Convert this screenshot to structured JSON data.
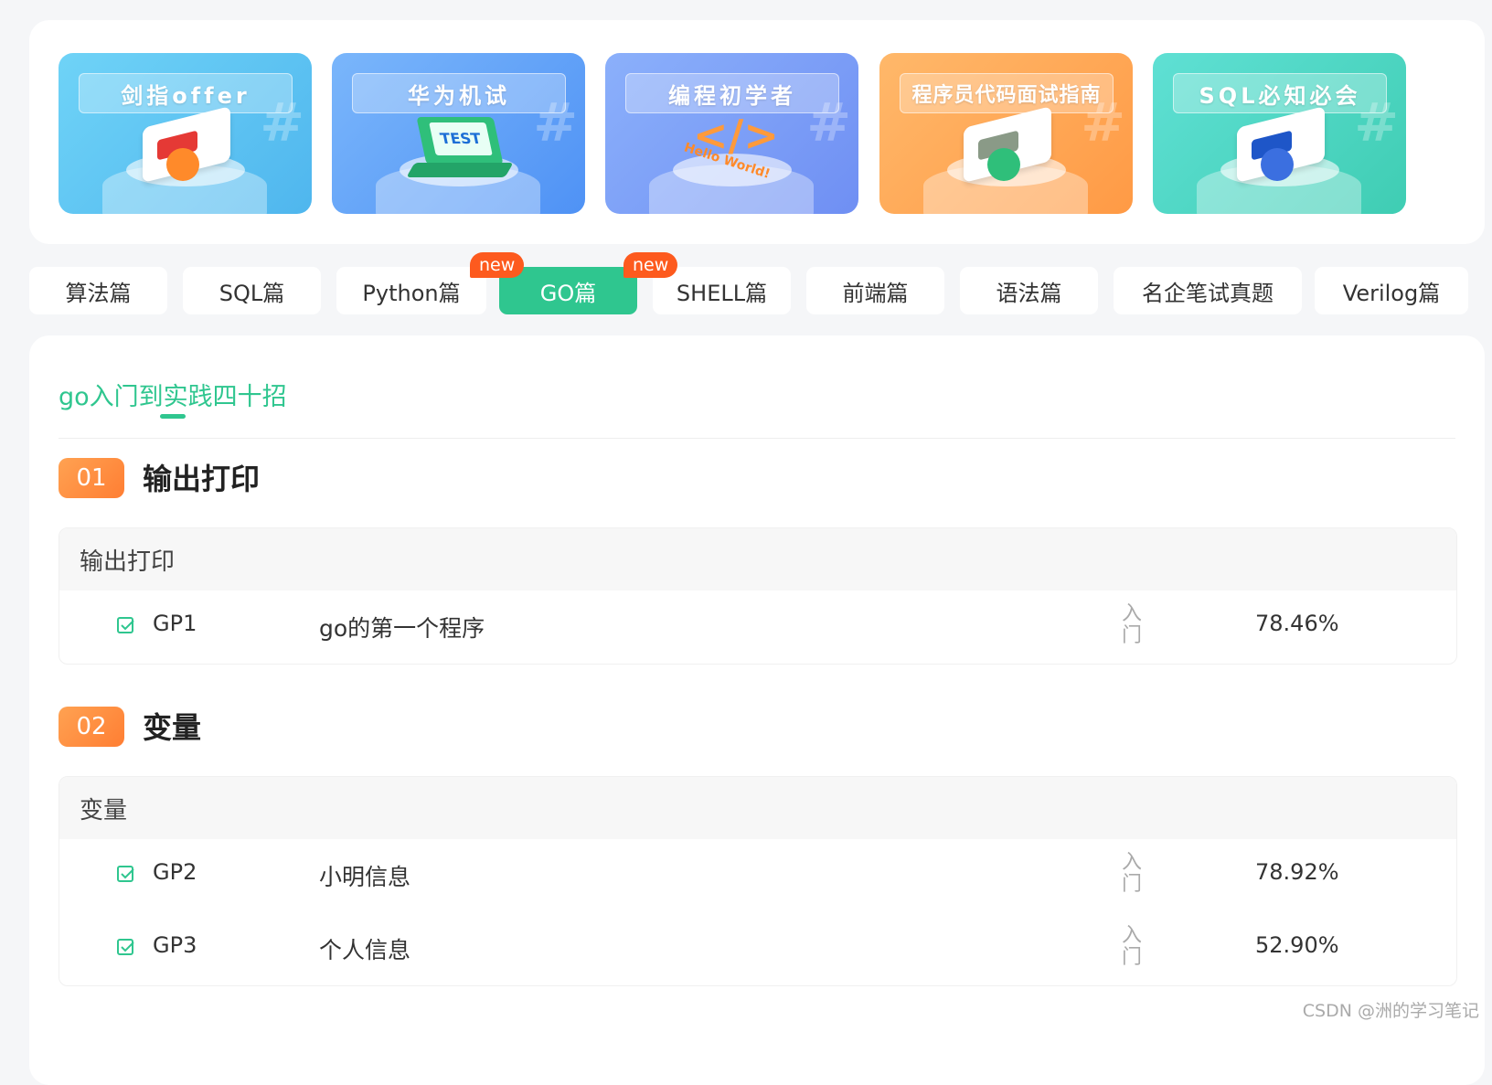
{
  "banners": [
    {
      "title": "剑指offer",
      "color": "#4fb6ee"
    },
    {
      "title": "华为机试",
      "color": "#4f92f5",
      "screen_text": "TEST"
    },
    {
      "title": "编程初学者",
      "color": "#6f8ff3",
      "art_text": "Hello World!"
    },
    {
      "title": "程序员代码面试指南",
      "color": "#ff9a45"
    },
    {
      "title": "SQL必知必会",
      "color": "#3fcdb3"
    }
  ],
  "tabs": [
    {
      "label": "算法篇"
    },
    {
      "label": "SQL篇"
    },
    {
      "label": "Python篇"
    },
    {
      "label": "GO篇",
      "active": true,
      "badge": "new"
    },
    {
      "label": "SHELL篇",
      "badge": "new"
    },
    {
      "label": "前端篇"
    },
    {
      "label": "语法篇"
    },
    {
      "label": "名企笔试真题"
    },
    {
      "label": "Verilog篇"
    }
  ],
  "course": {
    "title": "go入门到实践四十招"
  },
  "sections": [
    {
      "number": "01",
      "title": "输出打印",
      "group_title": "输出打印",
      "problems": [
        {
          "code": "GP1",
          "name": "go的第一个程序",
          "level": "入门",
          "rate": "78.46%"
        }
      ]
    },
    {
      "number": "02",
      "title": "变量",
      "group_title": "变量",
      "problems": [
        {
          "code": "GP2",
          "name": "小明信息",
          "level": "入门",
          "rate": "78.92%"
        },
        {
          "code": "GP3",
          "name": "个人信息",
          "level": "入门",
          "rate": "52.90%"
        }
      ]
    }
  ],
  "watermark": "CSDN @洲的学习笔记",
  "colors": {
    "accent": "#2fc68f",
    "badge": "#fd5a1e",
    "section_number": "#ff8a3a"
  }
}
